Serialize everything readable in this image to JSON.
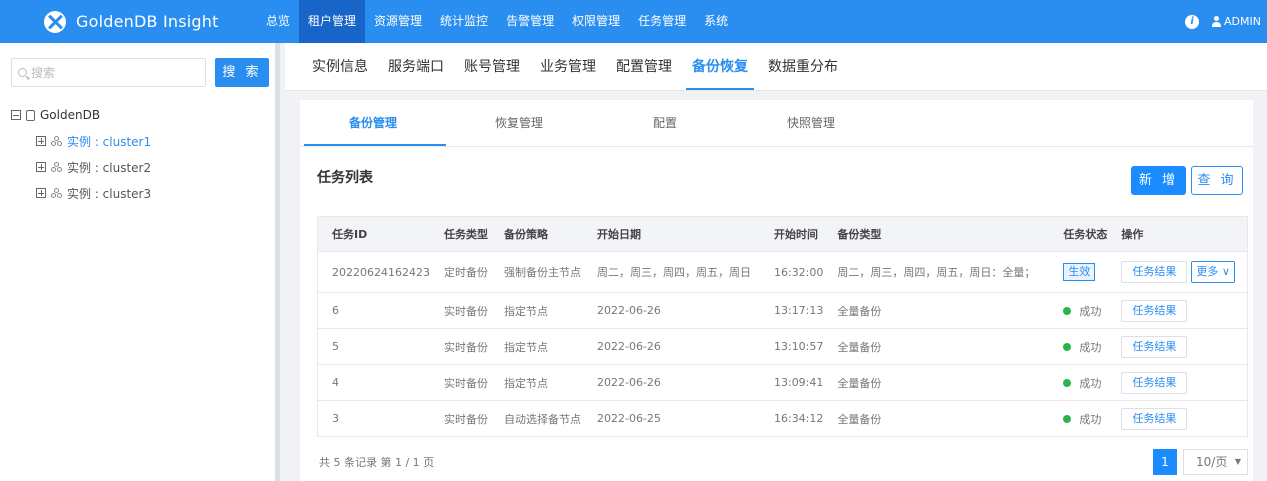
{
  "app": {
    "title": "GoldenDB Insight"
  },
  "nav": [
    "总览",
    "租户管理",
    "资源管理",
    "统计监控",
    "告警管理",
    "权限管理",
    "任务管理",
    "系统"
  ],
  "user": {
    "name": "ADMIN"
  },
  "sidebar": {
    "search_placeholder": "搜索",
    "search_button": "搜 索",
    "tree": {
      "root": "GoldenDB",
      "children": [
        "实例 : cluster1",
        "实例 : cluster2",
        "实例 : cluster3"
      ]
    }
  },
  "subtabs": [
    "实例信息",
    "服务端口",
    "账号管理",
    "业务管理",
    "配置管理",
    "备份恢复",
    "数据重分布"
  ],
  "inner_tabs": [
    "备份管理",
    "恢复管理",
    "配置",
    "快照管理"
  ],
  "list": {
    "title": "任务列表",
    "add_button": "新 增",
    "query_button": "查 询",
    "columns": [
      "任务ID",
      "任务类型",
      "备份策略",
      "开始日期",
      "开始时间",
      "备份类型",
      "任务状态",
      "操作"
    ],
    "rows": [
      {
        "id": "20220624162423",
        "type": "定时备份",
        "strategy": "强制备份主节点",
        "date": "周二，周三，周四，周五，周日",
        "time": "16:32:00",
        "backup_type": "周二，周三，周四，周五，周日：全量；",
        "status": "生效",
        "action": "任务结果",
        "more": "更多"
      },
      {
        "id": "6",
        "type": "实时备份",
        "strategy": "指定节点",
        "date": "2022-06-26",
        "time": "13:17:13",
        "backup_type": "全量备份",
        "status": "成功",
        "action": "任务结果"
      },
      {
        "id": "5",
        "type": "实时备份",
        "strategy": "指定节点",
        "date": "2022-06-26",
        "time": "13:10:57",
        "backup_type": "全量备份",
        "status": "成功",
        "action": "任务结果"
      },
      {
        "id": "4",
        "type": "实时备份",
        "strategy": "指定节点",
        "date": "2022-06-26",
        "time": "13:09:41",
        "backup_type": "全量备份",
        "status": "成功",
        "action": "任务结果"
      },
      {
        "id": "3",
        "type": "实时备份",
        "strategy": "自动选择备节点",
        "date": "2022-06-25",
        "time": "16:34:12",
        "backup_type": "全量备份",
        "status": "成功",
        "action": "任务结果"
      }
    ],
    "footer": "共 5 条记录  第 1 / 1 页",
    "page": "1",
    "page_size": "10/页"
  },
  "colors": {
    "primary": "#2a8ef0",
    "success": "#2bb34f",
    "active_nav": "#1765c8"
  }
}
